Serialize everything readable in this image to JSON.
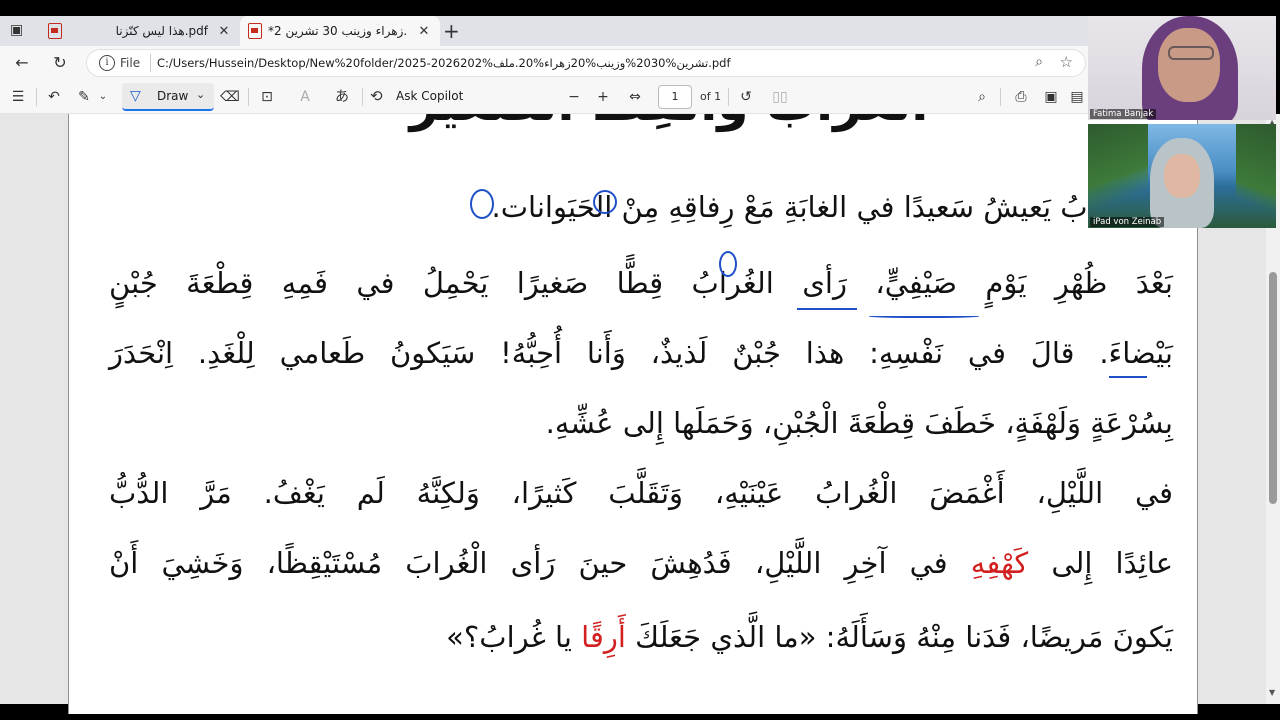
{
  "browser": {
    "tabs": [
      {
        "title": "هذا ليس كنّزنا.pdf",
        "active": false
      },
      {
        "title": "*زهراء وزينب 30 تشرين 2.pdf",
        "active": true
      }
    ],
    "scheme_label": "File",
    "url": "C:/Users/Hussein/Desktop/New%20folder/2025-2026202%تشرين%2030%وزينب%20زهراء%20.ملف.pdf"
  },
  "pdf_toolbar": {
    "draw_label": "Draw",
    "copilot_label": "Ask Copilot",
    "page_current": "1",
    "page_total": "of 1"
  },
  "document": {
    "title": "الغُرابُ وَالْقِطُّ الصَّغيرُ",
    "lines": [
      "نَ الغُرابُ يَعيشُ سَعيدًا في الغابَةِ مَعْ رِفاقِهِ مِنْ الحَيَوانات.",
      "بَعْدَ ظُهْرِ يَوْمٍ صَيْفِيٍّ، رَأى الغُرابُ قِطًّا صَغيرًا يَحْمِلُ في فَمِهِ قِطْعَةَ جُبْنٍ",
      "بَيْضاءَ. قالَ في نَفْسِهِ: هذا جُبْنٌ لَذيذٌ، وَأَنا أُحِبُّهُ! سَيَكونُ طَعامي لِلْغَدِ. اِنْحَدَرَ",
      "بِسُرْعَةٍ وَلَهْفَةٍ، خَطَفَ قِطْعَةَ الْجُبْنِ، وَحَمَلَها إِلى عُشِّهِ.",
      "في اللَّيْلِ، أَغْمَضَ الْغُرابُ عَيْنَيْهِ، وَتَقَلَّبَ كَثيرًا، وَلكِنَّهُ لَم يَغْفُ. مَرَّ الدُّبُّ",
      {
        "before": "عائِدًا إِلى ",
        "red": "كَهْفِهِ",
        "after": " في آخِرِ اللَّيْلِ، فَدُهِشَ حينَ رَأى الْغُرابَ مُسْتَيْقِظًا، وَخَشِيَ أَنْ"
      },
      {
        "before": "يَكونَ مَريضًا، فَدَنا مِنْهُ وَسَأَلَهُ: «ما الَّذي جَعَلَكَ ",
        "red": "أَرِقًا",
        "after": " يا غُرابُ؟»"
      }
    ]
  },
  "participants": [
    {
      "name": "Fatima Banjak"
    },
    {
      "name": "iPad von Zeinab"
    }
  ],
  "colors": {
    "highlight_red": "#d21f1f",
    "annotation_blue": "#1f50c8",
    "accent": "#1a73e8"
  }
}
